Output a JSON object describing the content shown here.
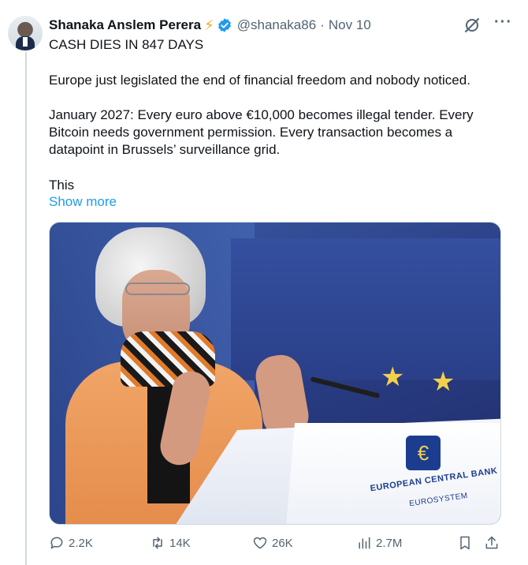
{
  "tweet": {
    "author_name": "Shanaka Anslem Perera",
    "handle": "@shanaka86",
    "separator": "·",
    "date": "Nov 10",
    "paragraphs": [
      "CASH DIES IN 847 DAYS",
      "Europe just legislated the end of financial freedom and nobody noticed.",
      "January 2027: Every euro above €10,000 becomes illegal tender. Every Bitcoin needs government permission. Every transaction becomes a datapoint in Brussels’ surveillance grid.",
      "This"
    ],
    "show_more": "Show more"
  },
  "media": {
    "bank_name": "EUROPEAN CENTRAL BANK",
    "bank_sub": "EUROSYSTEM",
    "logo_glyph": "€"
  },
  "actions": {
    "replies": "2.2K",
    "reposts": "14K",
    "likes": "26K",
    "views": "2.7M"
  },
  "icons": {
    "verified": "verified-badge-icon",
    "bolt": "⚡",
    "more": "···"
  },
  "colors": {
    "accent": "#1d9bf0",
    "secondary_text": "#536471"
  }
}
